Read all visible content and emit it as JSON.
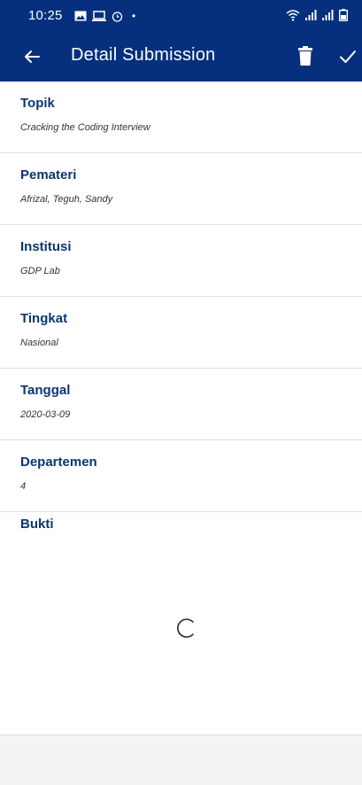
{
  "status_bar": {
    "time": "10:25",
    "notification_icons": [
      "gallery-icon",
      "laptop-icon",
      "alarm-icon"
    ],
    "dot": "•",
    "right_icons": [
      "wifi-icon",
      "signal-icon",
      "signal-icon",
      "battery-icon"
    ]
  },
  "app_bar": {
    "title": "Detail Submission",
    "background": "#062f7d",
    "actions": [
      "delete-icon",
      "check-icon"
    ]
  },
  "fields": [
    {
      "label": "Topik",
      "value": "Cracking the Coding Interview"
    },
    {
      "label": "Pemateri",
      "value": "Afrizal, Teguh, Sandy"
    },
    {
      "label": "Institusi",
      "value": "GDP Lab"
    },
    {
      "label": "Tingkat",
      "value": "Nasional"
    },
    {
      "label": "Tanggal",
      "value": "2020-03-09"
    },
    {
      "label": "Departemen",
      "value": "4"
    }
  ],
  "bukti": {
    "label": "Bukti",
    "loading": true
  },
  "colors": {
    "label": "#0c3570",
    "divider": "#e0e0e0",
    "bottom_bar": "#f3f3f3"
  }
}
